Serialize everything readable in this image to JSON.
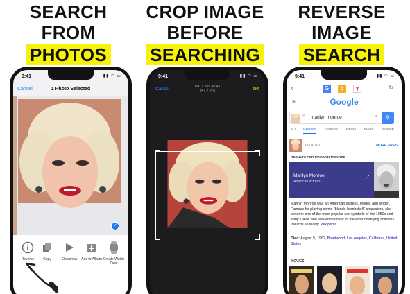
{
  "panels": [
    {
      "headline": [
        "SEARCH",
        "FROM",
        "PHOTOS"
      ],
      "status_time": "9:41",
      "nav": {
        "cancel": "Cancel",
        "title": "1 Photo Selected"
      },
      "actions": [
        {
          "label": "Reverse",
          "icon": "info-icon"
        },
        {
          "label": "Copy",
          "icon": "copy-icon"
        },
        {
          "label": "Slideshow",
          "icon": "play-icon"
        },
        {
          "label": "Add to Album",
          "icon": "add-album-icon"
        },
        {
          "label": "Create Watch Face",
          "icon": "watch-icon"
        }
      ]
    },
    {
      "headline": [
        "CROP IMAGE",
        "BEFORE",
        "SEARCHING"
      ],
      "status_time": "9:41",
      "cancel": "Cancel",
      "ok": "OK",
      "dims_line1": "600 × 395  45:43",
      "dims_line2": "347 × 276"
    },
    {
      "headline": [
        "REVERSE",
        "IMAGE",
        "SEARCH"
      ],
      "status_time": "9:41",
      "logo": "Google",
      "query": "marilyn monroe",
      "tabs": [
        "ALL",
        "IMAGES",
        "VIDEOS",
        "NEWS",
        "MAPS",
        "SHOPP"
      ],
      "image_size": "176 × 201",
      "more_sizes": "MORE SIZES",
      "results_heading": "RESULTS FOR MARILYN MONROE",
      "kp_name": "Marilyn Monroe",
      "kp_subtitle": "American actress",
      "description": "Marilyn Monroe was an American actress, model, and singer. Famous for playing comic \"blonde bombshell\" characters, she became one of the most popular sex symbols of the 1950s and early 1960s and was emblematic of the era's changing attitudes towards sexuality.",
      "wiki": "Wikipedia",
      "died_label": "Died",
      "died_text": ": August 5, 1962,",
      "died_links": [
        "Brentwood",
        "Los Angeles",
        "California",
        "United States"
      ],
      "movies_heading": "MOVIES"
    }
  ],
  "colors": {
    "highlight": "#f6f20a",
    "ios_blue": "#1b7cf2",
    "knowledge_panel": "#3b3c8c"
  }
}
